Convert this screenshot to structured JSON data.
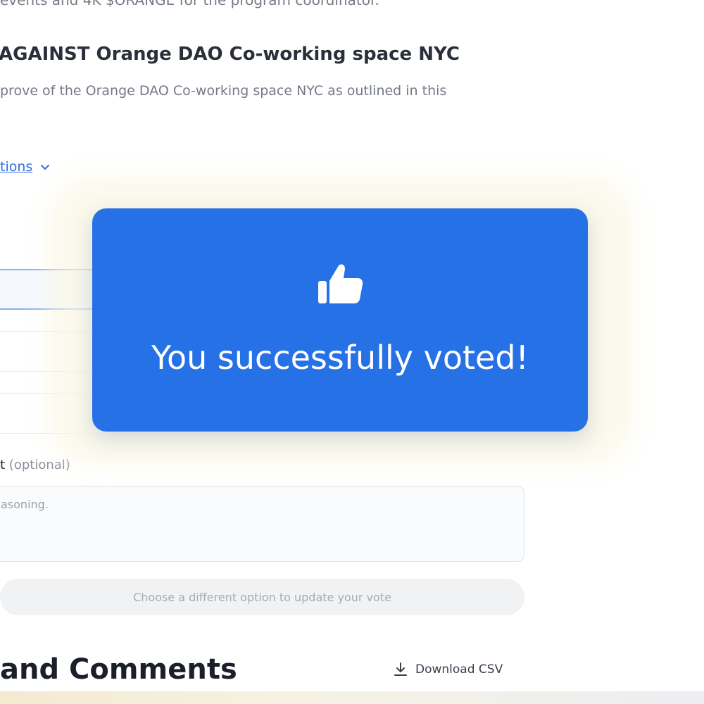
{
  "proposal": {
    "truncated_line": "events and 4K $ORANGE for the program coordinator.",
    "option_title": "AGAINST Orange DAO Co-working space NYC",
    "option_description": "prove of the Orange DAO Co-working space NYC as outlined in this",
    "options_toggle_label": "tions"
  },
  "comment": {
    "label": "t",
    "optional_label": "(optional)",
    "placeholder": "asoning."
  },
  "update_vote_label": "Choose a different option to update your vote",
  "section_heading": "and Comments",
  "download_csv_label": "Download CSV",
  "toast": {
    "message": "You successfully voted!",
    "icon": "thumbs-up-icon",
    "background": "#2671e6"
  }
}
